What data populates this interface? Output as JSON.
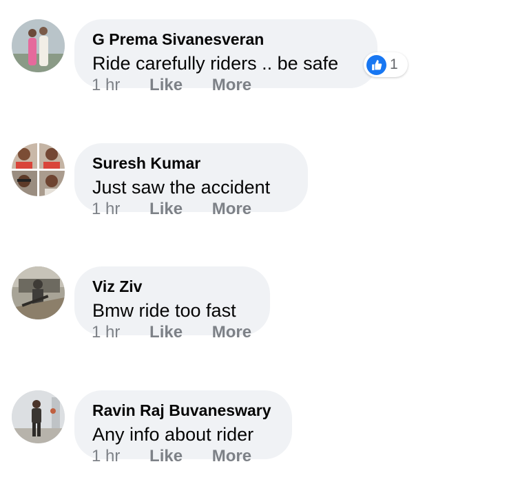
{
  "comments": [
    {
      "author": "G Prema Sivanesveran",
      "text": "Ride carefully riders .. be safe",
      "time": "1 hr",
      "like_label": "Like",
      "more_label": "More",
      "reactions": {
        "icon": "thumbs-up-icon",
        "count": "1",
        "color": "#1877f2"
      }
    },
    {
      "author": "Suresh Kumar",
      "text": "Just saw the accident",
      "time": "1 hr",
      "like_label": "Like",
      "more_label": "More"
    },
    {
      "author": "Viz Ziv",
      "text": "Bmw ride too fast",
      "time": "1 hr",
      "like_label": "Like",
      "more_label": "More"
    },
    {
      "author": "Ravin Raj Buvaneswary",
      "text": "Any info about rider",
      "time": "1 hr",
      "like_label": "Like",
      "more_label": "More"
    }
  ],
  "colors": {
    "bubble": "#f0f2f5",
    "author_text": "#050505",
    "meta_text": "#7d8187",
    "like_blue": "#1877f2"
  }
}
